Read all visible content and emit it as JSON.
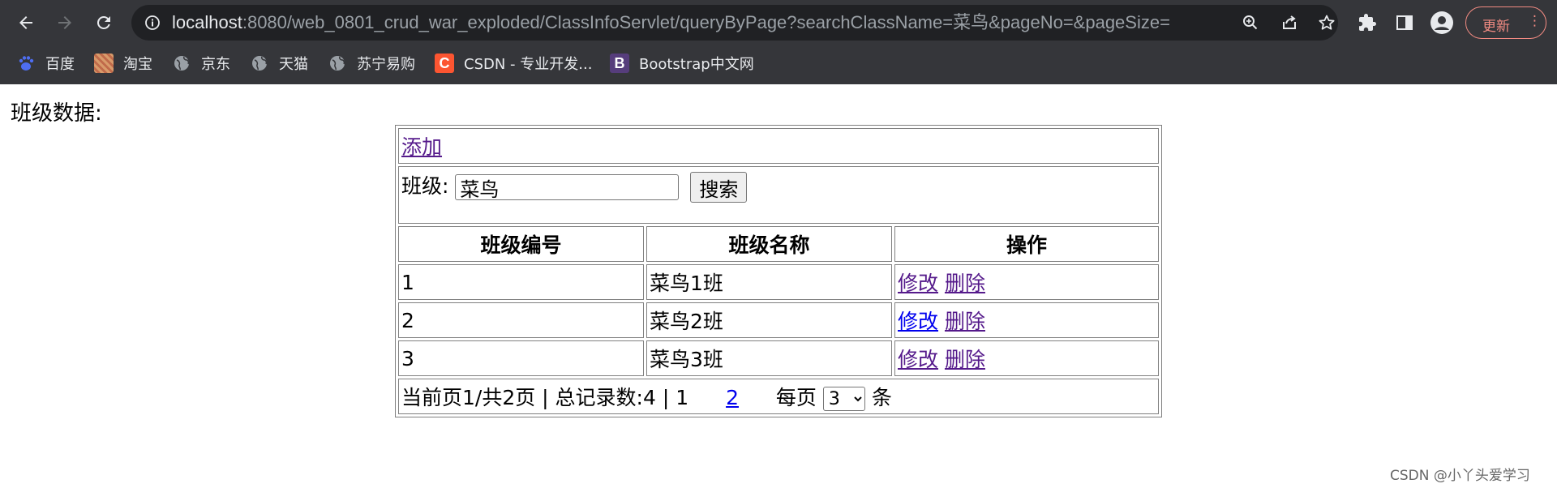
{
  "browser": {
    "url_host": "localhost",
    "url_rest": ":8080/web_0801_crud_war_exploded/ClassInfoServlet/queryByPage?searchClassName=菜鸟&pageNo=&pageSize=",
    "update_label": "更新",
    "menu_glyph": "⋮",
    "bookmarks": [
      {
        "label": "百度",
        "icon": "baidu-icon"
      },
      {
        "label": "淘宝",
        "icon": "taobao-icon"
      },
      {
        "label": "京东",
        "icon": "globe-icon"
      },
      {
        "label": "天猫",
        "icon": "globe-icon"
      },
      {
        "label": "苏宁易购",
        "icon": "globe-icon"
      },
      {
        "label": "CSDN - 专业开发...",
        "icon": "csdn-icon",
        "icon_text": "C"
      },
      {
        "label": "Bootstrap中文网",
        "icon": "bootstrap-icon",
        "icon_text": "B"
      }
    ]
  },
  "page": {
    "title": "班级数据:",
    "add_link": "添加",
    "search": {
      "label": "班级:",
      "value": "菜鸟",
      "button": "搜索"
    },
    "table": {
      "headers": [
        "班级编号",
        "班级名称",
        "操作"
      ],
      "rows": [
        {
          "id": "1",
          "name": "菜鸟1班",
          "edit": "修改",
          "delete": "删除"
        },
        {
          "id": "2",
          "name": "菜鸟2班",
          "edit": "修改",
          "delete": "删除"
        },
        {
          "id": "3",
          "name": "菜鸟3班",
          "edit": "修改",
          "delete": "删除"
        }
      ]
    },
    "pagination": {
      "text": "当前页1/共2页 | 总记录数:4 | 1",
      "next_page": "2",
      "per_page_label": "每页",
      "per_page_value": "3",
      "unit": "条"
    }
  },
  "watermark": "CSDN @小丫头爱学习",
  "colors": {
    "chrome_bg": "#35363a",
    "omnibox_bg": "#202124",
    "visited_link": "#551a8b",
    "link": "#0000ee",
    "update_accent": "#f28b82"
  }
}
